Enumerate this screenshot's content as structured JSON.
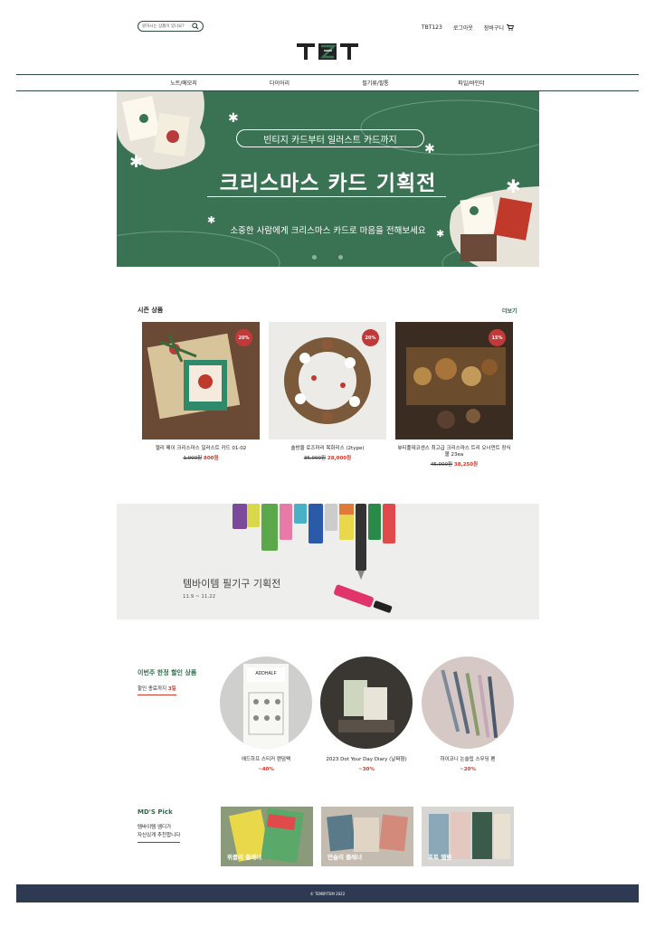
{
  "header": {
    "search_placeholder": "원하시는 상품이 있나요?",
    "links": [
      "TBT123",
      "로그아웃",
      "장바구니"
    ],
    "logo_text": "TBT"
  },
  "nav": [
    "노트/메모지",
    "다이어리",
    "필기류/필통",
    "파일/바인더"
  ],
  "hero": {
    "pill": "빈티지 카드부터 일러스트 카드까지",
    "title": "크리스마스 카드 기획전",
    "subtitle": "소중한 사람에게 크리스마스 카드로 마음을 전해보세요",
    "bg_color": "#3a7354"
  },
  "season": {
    "title": "시즌 상품",
    "more": "더보기",
    "products": [
      {
        "name": "젤리 메이 크리스마스 일러스트 카드 01-02",
        "badge": "20%",
        "orig": "1,000원",
        "sale": "800원"
      },
      {
        "name": "솔방울 로즈마리 목화리스 (2type)",
        "badge": "20%",
        "orig": "35,000원",
        "sale": "28,000원"
      },
      {
        "name": "뷰티풀데코센스 최고급 크리스마스 트리 오너먼트 장식볼 23ea",
        "badge": "15%",
        "orig": "45,000원",
        "sale": "38,250원"
      }
    ]
  },
  "pen_banner": {
    "title": "템바이템 필기구 기획전",
    "date": "11.9 ~ 11.22"
  },
  "weekly": {
    "title": "이번주 한정 할인 상품",
    "sub_prefix": "할인 종료까지 ",
    "sub_days": "3일",
    "items": [
      {
        "name": "애드하프 스티커 랜덤팩",
        "disc": "~40%"
      },
      {
        "name": "2023 Dot Your Day Diary (날짜형)",
        "disc": "~30%"
      },
      {
        "name": "하이코니 논슬립 스무딩 펜",
        "disc": "~20%"
      }
    ]
  },
  "md": {
    "title": "MD'S Pick",
    "sub1": "템바이템 엠디가",
    "sub2": "자신있게 추천합니다",
    "items": [
      {
        "label": "위클리 플래너"
      },
      {
        "label": "먼슬리 플래너"
      },
      {
        "label": "포토 앨범"
      }
    ]
  },
  "footer": {
    "text": "© TEMBYTEM 2022"
  },
  "colors": {
    "brand_green": "#2e6b4a",
    "sale_red": "#d23a2a",
    "footer_navy": "#2e3a52"
  }
}
